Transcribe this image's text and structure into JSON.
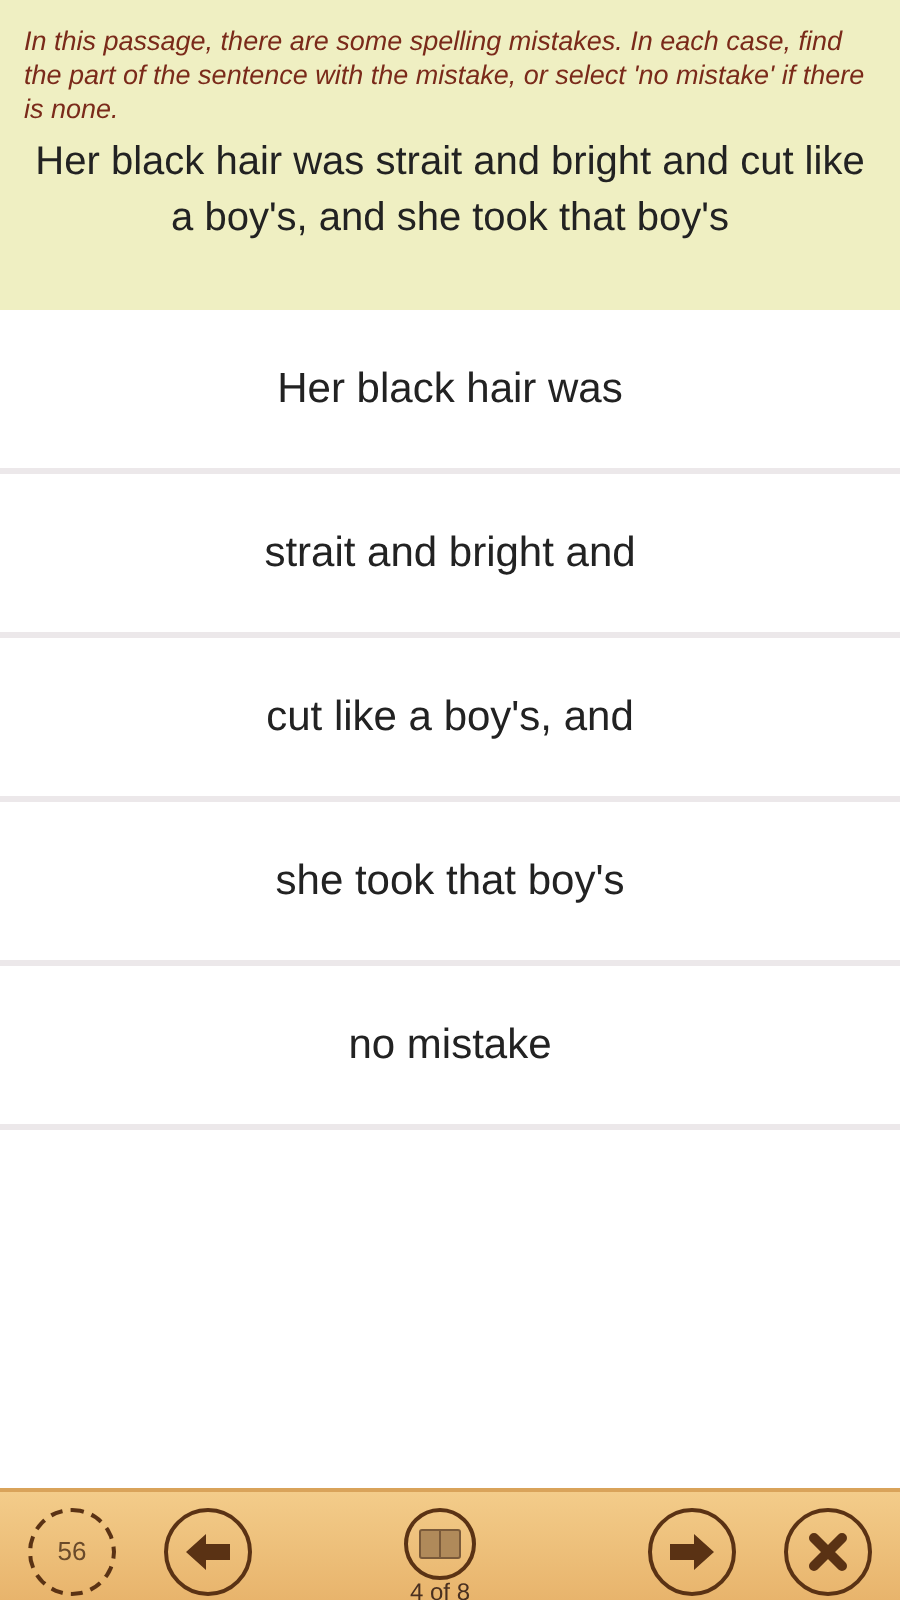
{
  "instructions": "In this passage, there are some spelling mistakes. In each case, find the part of the sentence with the mistake, or select 'no mistake' if there is none.",
  "passage": "Her black hair was strait and bright and cut like a boy's, and she took that boy's",
  "options": [
    {
      "label": "Her black hair was"
    },
    {
      "label": "strait and bright and"
    },
    {
      "label": "cut like a boy's, and"
    },
    {
      "label": "she took that boy's"
    },
    {
      "label": "no mistake"
    }
  ],
  "toolbar": {
    "timer": "56",
    "progress": "4 of 8"
  }
}
